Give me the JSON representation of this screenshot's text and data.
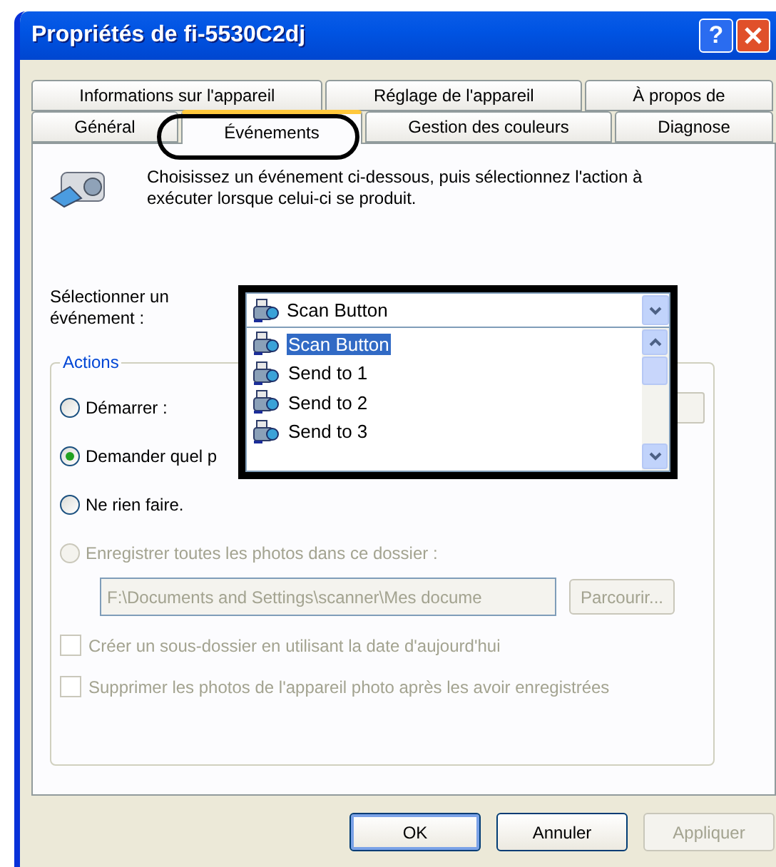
{
  "window": {
    "title": "Propriétés de fi-5530C2dj"
  },
  "help_button": {
    "label": "?"
  },
  "tab_rows": [
    [
      {
        "label": "Informations sur l'appareil",
        "selected": false
      },
      {
        "label": "Réglage de l'appareil",
        "selected": false
      },
      {
        "label": "À propos de",
        "selected": false
      }
    ],
    [
      {
        "label": "Général",
        "selected": false
      },
      {
        "label": "Événements",
        "selected": true
      },
      {
        "label": "Gestion des couleurs",
        "selected": false
      },
      {
        "label": "Diagnose",
        "selected": false
      }
    ]
  ],
  "description": "Choisissez un événement ci-dessous, puis sélectionnez l'action à exécuter lorsque celui-ci se produit.",
  "event_select": {
    "label": "Sélectionner un événement :",
    "value": "Scan Button",
    "options": [
      {
        "label": "Scan Button",
        "selected": true
      },
      {
        "label": "Send to 1",
        "selected": false
      },
      {
        "label": "Send to 2",
        "selected": false
      },
      {
        "label": "Send to 3",
        "selected": false
      }
    ]
  },
  "actions": {
    "title": "Actions",
    "options": [
      {
        "label": "Démarrer :",
        "selected": false,
        "disabled": false
      },
      {
        "label": "Demander quel p",
        "selected": true,
        "disabled": false
      },
      {
        "label": "Ne rien faire.",
        "selected": false,
        "disabled": false
      },
      {
        "label": "Enregistrer toutes les photos dans ce dossier :",
        "selected": false,
        "disabled": true
      }
    ],
    "folder": {
      "value": "F:\\Documents and Settings\\scanner\\Mes docume",
      "disabled": true
    },
    "browse": {
      "label": "Parcourir...",
      "disabled": true
    },
    "checkboxes": [
      {
        "label": "Créer un sous-dossier en utilisant la date d'aujourd'hui",
        "checked": false,
        "disabled": true
      },
      {
        "label": "Supprimer les photos de l'appareil photo après les avoir enregistrées",
        "checked": false,
        "disabled": true
      }
    ]
  },
  "buttons": [
    {
      "label": "OK",
      "disabled": false,
      "default": true
    },
    {
      "label": "Annuler",
      "disabled": false,
      "default": false
    },
    {
      "label": "Appliquer",
      "disabled": true,
      "default": false
    }
  ]
}
